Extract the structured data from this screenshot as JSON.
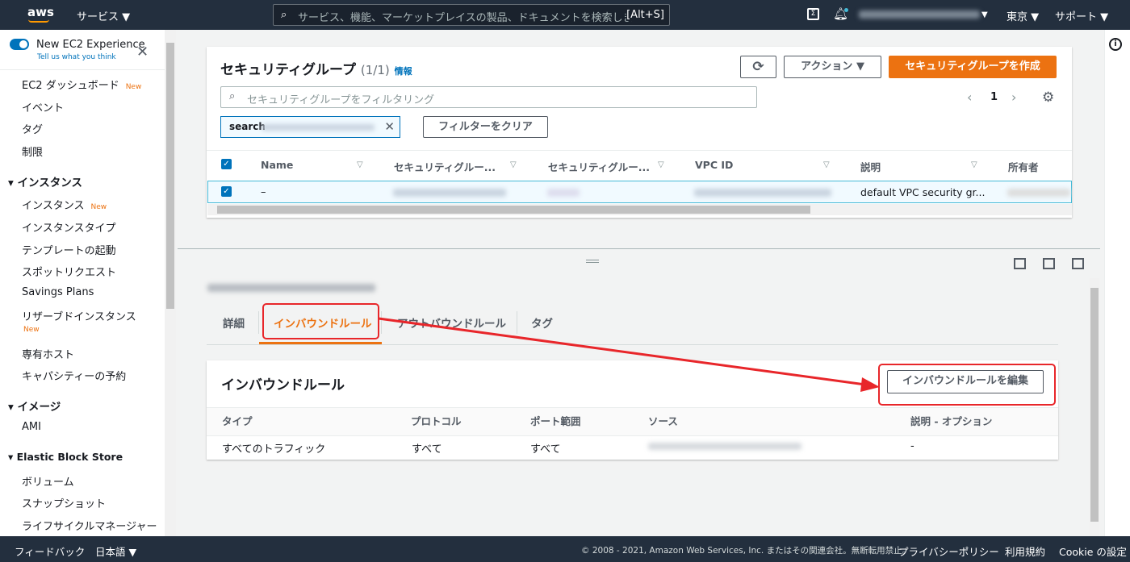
{
  "topnav": {
    "brand": "aws",
    "services": "サービス ▼",
    "search_placeholder": "サービス、機能、マーケットプレイスの製品、ドキュメントを検索しま",
    "search_shortcut": "[Alt+S]",
    "region": "東京 ▼",
    "support": "サポート ▼"
  },
  "sidebar": {
    "toggle_label": "New EC2 Experience",
    "toggle_sub": "Tell us what you think",
    "items": [
      {
        "label": "EC2 ダッシュボード",
        "badge": "New"
      },
      {
        "label": "イベント"
      },
      {
        "label": "タグ"
      },
      {
        "label": "制限"
      }
    ],
    "instances": {
      "title": "インスタンス",
      "items": [
        {
          "label": "インスタンス",
          "badge": "New"
        },
        {
          "label": "インスタンスタイプ"
        },
        {
          "label": "テンプレートの起動"
        },
        {
          "label": "スポットリクエスト"
        },
        {
          "label": "Savings Plans"
        },
        {
          "label": "リザーブドインスタンス",
          "badge": "New"
        },
        {
          "label": "専有ホスト"
        },
        {
          "label": "キャパシティーの予約"
        }
      ]
    },
    "images": {
      "title": "イメージ",
      "items": [
        {
          "label": "AMI"
        }
      ]
    },
    "ebs": {
      "title": "Elastic Block Store",
      "items": [
        {
          "label": "ボリューム"
        },
        {
          "label": "スナップショット"
        },
        {
          "label": "ライフサイクルマネージャー"
        }
      ]
    }
  },
  "sg_panel": {
    "title": "セキュリティグループ",
    "count": "(1/1)",
    "info": "情報",
    "actions": "アクション ▼",
    "create": "セキュリティグループを作成",
    "filter_placeholder": "セキュリティグループをフィルタリング",
    "filter_token": "search",
    "clear_filter": "フィルターをクリア",
    "page": "1",
    "columns": [
      "Name",
      "セキュリティグルー...",
      "セキュリティグルー...",
      "VPC ID",
      "説明",
      "所有者"
    ],
    "row": {
      "name": "–",
      "description": "default VPC security gr..."
    }
  },
  "detail": {
    "tabs": [
      "詳細",
      "インバウンドルール",
      "アウトバウンドルール",
      "タグ"
    ],
    "section_title": "インバウンドルール",
    "edit_button": "インバウンドルールを編集",
    "columns": [
      "タイプ",
      "プロトコル",
      "ポート範囲",
      "ソース",
      "説明 - オプション"
    ],
    "rows": [
      {
        "type": "すべてのトラフィック",
        "protocol": "すべて",
        "port": "すべて",
        "description": "-"
      }
    ]
  },
  "footer": {
    "feedback": "フィードバック",
    "language": "日本語 ▼",
    "copyright": "© 2008 - 2021, Amazon Web Services, Inc. またはその関連会社。無断転用禁止。",
    "privacy": "プライバシーポリシー",
    "terms": "利用規約",
    "cookie": "Cookie の設定"
  },
  "colors": {
    "nav": "#232f3e",
    "accent": "#ec7211",
    "link": "#0073bb",
    "annotation": "#e8262a"
  }
}
